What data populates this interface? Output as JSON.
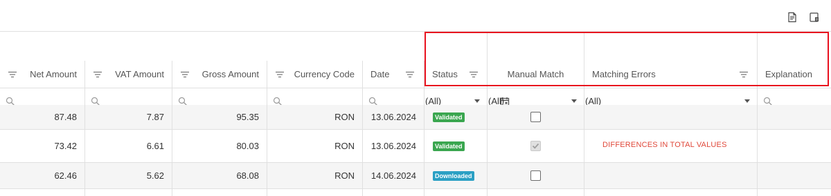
{
  "toolbar": {
    "export_excel_icon": "export-document-icon",
    "column_chooser_icon": "column-chooser-icon"
  },
  "columns": [
    {
      "key": "net_amount",
      "label": "Net Amount"
    },
    {
      "key": "vat_amount",
      "label": "VAT Amount"
    },
    {
      "key": "gross_amount",
      "label": "Gross Amount"
    },
    {
      "key": "currency_code",
      "label": "Currency Code"
    },
    {
      "key": "date",
      "label": "Date"
    },
    {
      "key": "status",
      "label": "Status"
    },
    {
      "key": "manual_match",
      "label": "Manual Match"
    },
    {
      "key": "matching_errors",
      "label": "Matching Errors"
    },
    {
      "key": "explanation",
      "label": "Explanation"
    }
  ],
  "filters": {
    "status": "(All)",
    "manual_match": "(All)",
    "matching_errors": "(All)"
  },
  "rows": [
    {
      "net_amount": "87.48",
      "vat_amount": "7.87",
      "gross_amount": "95.35",
      "currency_code": "RON",
      "date": "13.06.2024",
      "status": "Validated",
      "manual_match": false,
      "matching_errors": "",
      "explanation": ""
    },
    {
      "net_amount": "73.42",
      "vat_amount": "6.61",
      "gross_amount": "80.03",
      "currency_code": "RON",
      "date": "13.06.2024",
      "status": "Validated",
      "manual_match": true,
      "matching_errors": "DIFFERENCES IN TOTAL VALUES",
      "explanation": ""
    },
    {
      "net_amount": "62.46",
      "vat_amount": "5.62",
      "gross_amount": "68.08",
      "currency_code": "RON",
      "date": "14.06.2024",
      "status": "Downloaded",
      "manual_match": false,
      "matching_errors": "",
      "explanation": ""
    }
  ],
  "colors": {
    "validated": "#3aa64f",
    "downloaded": "#2ba0c4",
    "error_text": "#e0483a",
    "highlight": "#e8101e"
  }
}
